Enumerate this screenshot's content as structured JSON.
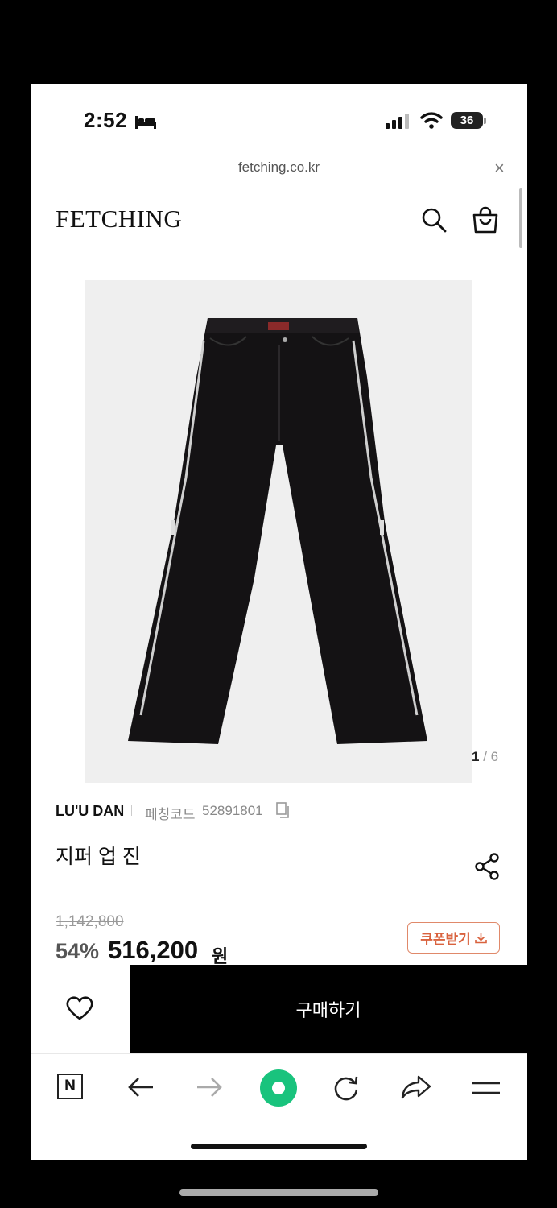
{
  "status_bar": {
    "time": "2:52",
    "battery": "36"
  },
  "browser": {
    "url": "fetching.co.kr",
    "close_glyph": "×"
  },
  "header": {
    "logo": "FETCHING"
  },
  "gallery": {
    "current": "1",
    "total": "6",
    "divider": "/"
  },
  "product": {
    "brand": "LU'U DAN",
    "code_label": "페칭코드",
    "code": "52891801",
    "name": "지퍼 업 진",
    "original_price": "1,142,800",
    "discount": "54%",
    "price": "516,200",
    "currency": "원",
    "coupon_label": "쿠폰받기"
  },
  "actions": {
    "buy_label": "구매하기"
  },
  "toolbar": {
    "n_label": "N"
  },
  "colors": {
    "accent_green": "#19c37d",
    "coupon_orange": "#d9623e"
  },
  "icons": [
    "bed-icon",
    "signal-icon",
    "wifi-icon",
    "close-icon",
    "search-icon",
    "bag-icon",
    "copy-icon",
    "share-icon",
    "download-icon",
    "heart-icon",
    "back-arrow-icon",
    "forward-arrow-icon",
    "home-circle-icon",
    "refresh-icon",
    "share-arrow-icon",
    "menu-icon"
  ]
}
